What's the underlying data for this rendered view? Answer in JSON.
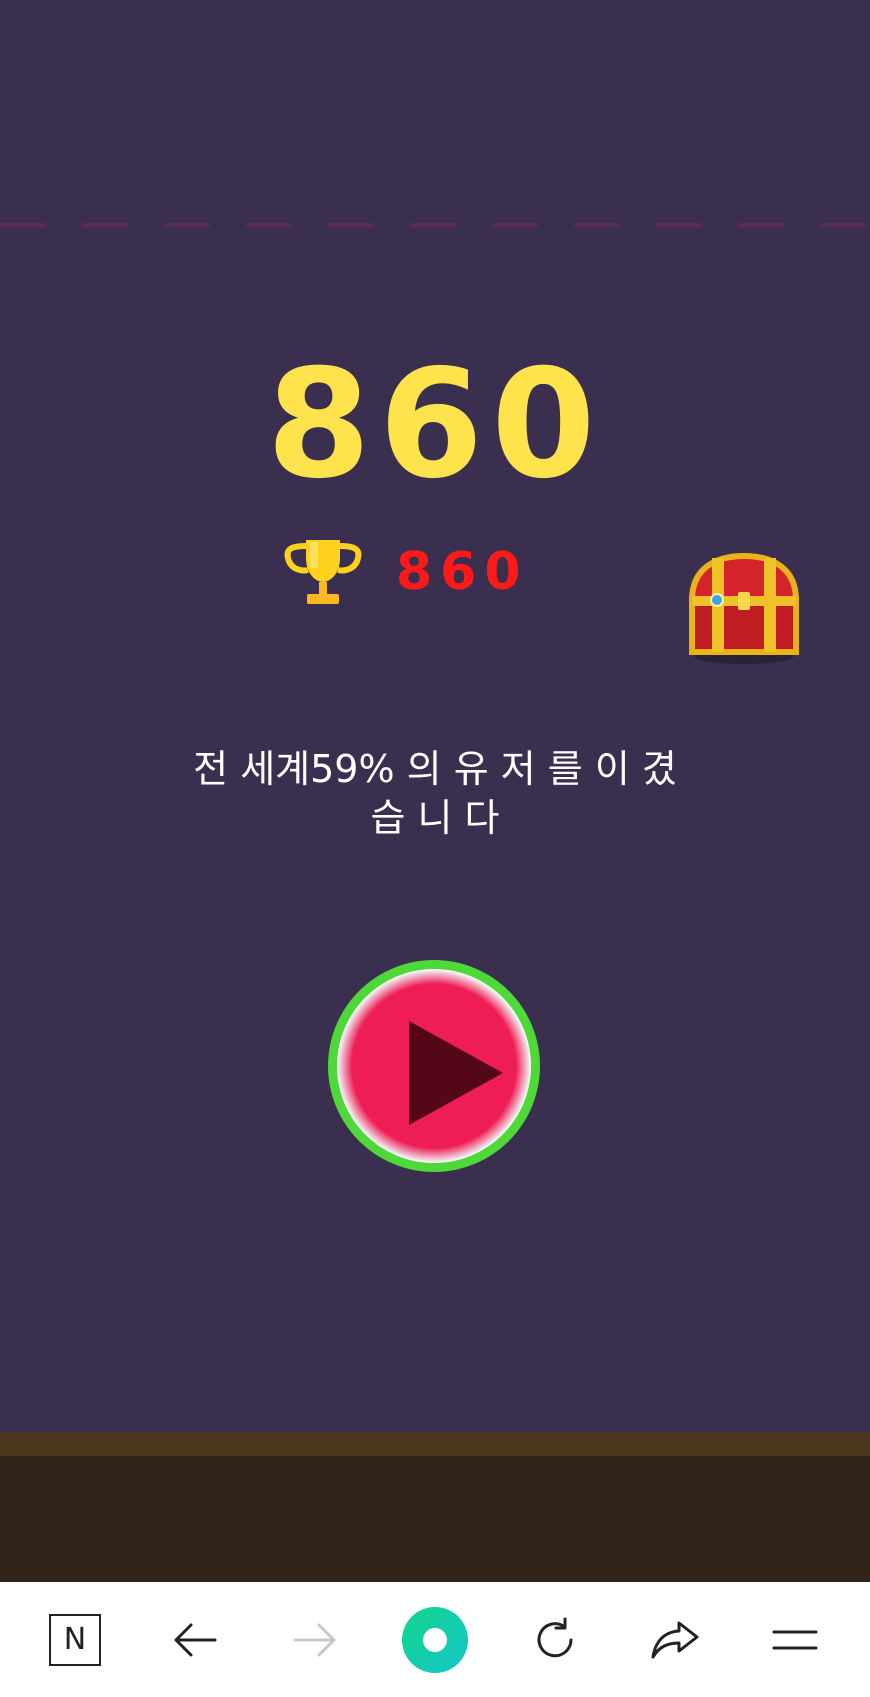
{
  "game": {
    "score": "860",
    "best_score": "860",
    "rank_line1": "전 세계59% 의 유 저 를 이 겼",
    "rank_line2": "습 니 다"
  },
  "icons": {
    "trophy": "trophy-icon",
    "chest": "treasure-chest-icon",
    "play": "play-icon"
  },
  "colors": {
    "background": "#3a2f4f",
    "score": "#ffe34d",
    "best_score": "#ff1a1a",
    "play_fill": "#ef1d56",
    "play_ring": "#4fd83a",
    "ground": "#33241a"
  },
  "browser_toolbar": {
    "home_label": "N",
    "items": [
      "home-n-icon",
      "back-arrow-icon",
      "forward-arrow-icon",
      "green-dot-icon",
      "refresh-icon",
      "share-icon",
      "menu-icon"
    ]
  }
}
